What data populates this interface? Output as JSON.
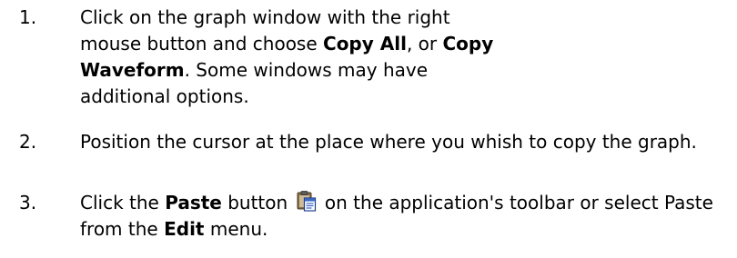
{
  "steps": [
    {
      "number": "1.",
      "parts": [
        "Click on the graph window with the right mouse button and choose ",
        "Copy All",
        ", or ",
        "Copy Waveform",
        ". Some windows may have additional options."
      ]
    },
    {
      "number": "2.",
      "text": "Position the cursor at the place where you whish to copy the graph."
    },
    {
      "number": "3.",
      "parts": [
        "Click the ",
        "Paste",
        " button",
        " on the application's toolbar or select Paste from the ",
        "Edit",
        " menu."
      ],
      "icon": "paste-icon"
    }
  ]
}
